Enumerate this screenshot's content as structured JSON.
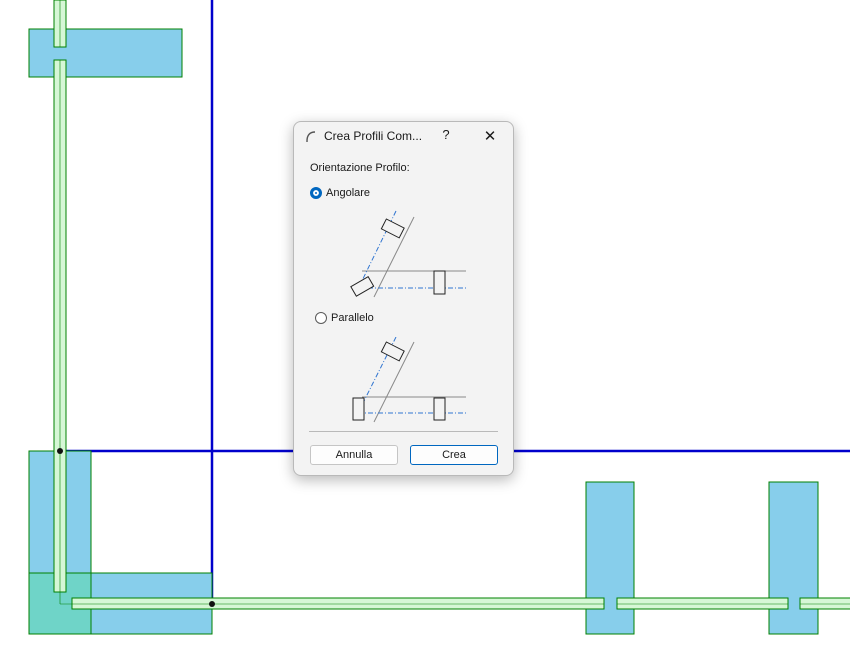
{
  "dialog": {
    "title": "Crea Profili Com...",
    "help_label": "?",
    "close_label": "✕",
    "section_label": "Orientazione Profilo:",
    "options": [
      {
        "label": "Angolare",
        "selected": true
      },
      {
        "label": "Parallelo",
        "selected": false
      }
    ],
    "cancel_label": "Annulla",
    "confirm_label": "Crea"
  },
  "colors": {
    "accent": "#0067c0",
    "wall_fill": "#87ceeb",
    "wall_stroke": "#008000",
    "profile_fill": "#d6f7d6",
    "axis_line": "#0000cc"
  }
}
